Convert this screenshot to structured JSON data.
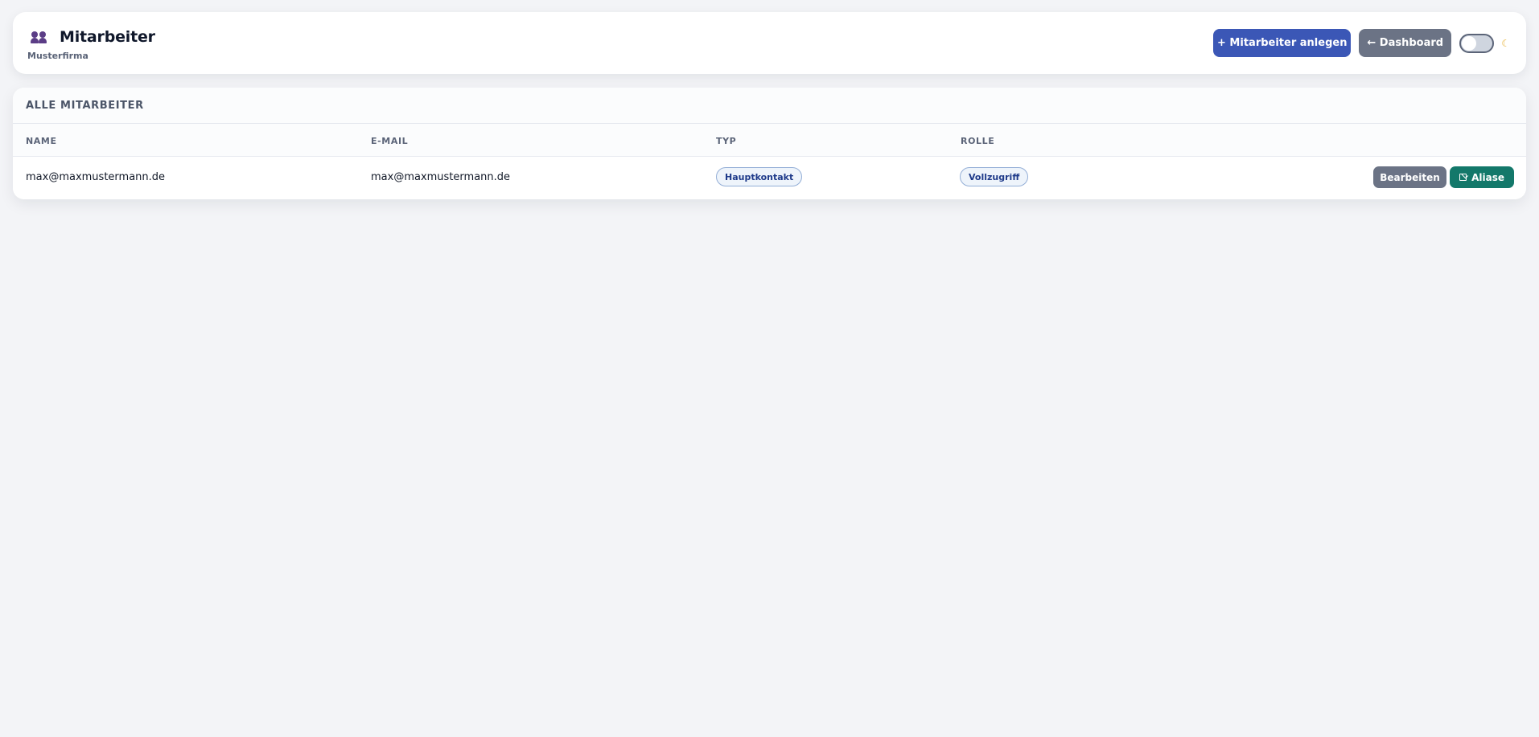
{
  "header": {
    "title": "Mitarbeiter",
    "subtitle": "Musterfirma",
    "add_button_label": "+ Mitarbeiter anlegen",
    "dashboard_button_label": "← Dashboard",
    "theme_toggle": {
      "state": "off",
      "icon": "moon-icon"
    }
  },
  "table": {
    "title": "ALLE MITARBEITER",
    "columns": [
      "NAME",
      "E-MAIL",
      "TYP",
      "ROLLE"
    ],
    "rows": [
      {
        "name": "max@maxmustermann.de",
        "email": "max@maxmustermann.de",
        "type": "Hauptkontakt",
        "role": "Vollzugriff",
        "edit_label": "Bearbeiten",
        "alias_label": "Aliase"
      }
    ]
  },
  "colors": {
    "primary": "#3b57b6",
    "secondary": "#6b7385",
    "alias": "#13786a",
    "background": "#f3f4f7"
  }
}
